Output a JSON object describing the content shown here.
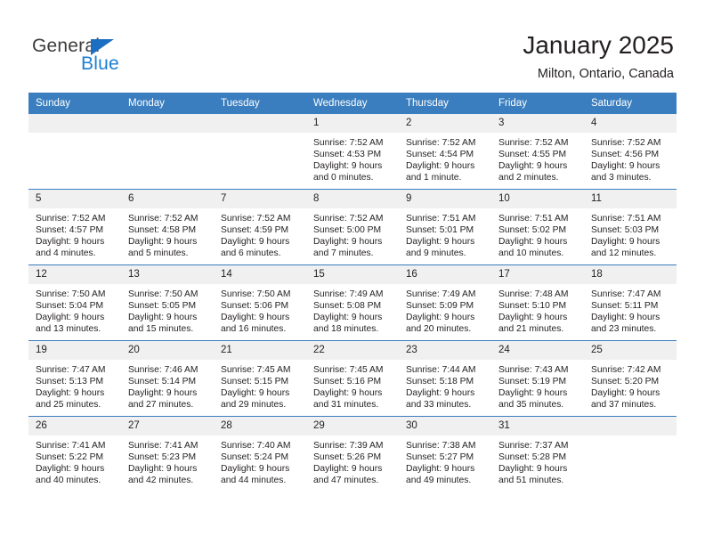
{
  "brand": {
    "name_part1": "General",
    "name_part2": "Blue",
    "accent_color": "#1b7fd4",
    "triangle_color": "#1b6ec2"
  },
  "header": {
    "title": "January 2025",
    "subtitle": "Milton, Ontario, Canada"
  },
  "calendar": {
    "header_bg": "#3a7ebf",
    "daynum_bg": "#f0f0f0",
    "weekdays": [
      "Sunday",
      "Monday",
      "Tuesday",
      "Wednesday",
      "Thursday",
      "Friday",
      "Saturday"
    ],
    "weeks": [
      [
        {
          "day": "",
          "lines": []
        },
        {
          "day": "",
          "lines": []
        },
        {
          "day": "",
          "lines": []
        },
        {
          "day": "1",
          "lines": [
            "Sunrise: 7:52 AM",
            "Sunset: 4:53 PM",
            "Daylight: 9 hours",
            "and 0 minutes."
          ]
        },
        {
          "day": "2",
          "lines": [
            "Sunrise: 7:52 AM",
            "Sunset: 4:54 PM",
            "Daylight: 9 hours",
            "and 1 minute."
          ]
        },
        {
          "day": "3",
          "lines": [
            "Sunrise: 7:52 AM",
            "Sunset: 4:55 PM",
            "Daylight: 9 hours",
            "and 2 minutes."
          ]
        },
        {
          "day": "4",
          "lines": [
            "Sunrise: 7:52 AM",
            "Sunset: 4:56 PM",
            "Daylight: 9 hours",
            "and 3 minutes."
          ]
        }
      ],
      [
        {
          "day": "5",
          "lines": [
            "Sunrise: 7:52 AM",
            "Sunset: 4:57 PM",
            "Daylight: 9 hours",
            "and 4 minutes."
          ]
        },
        {
          "day": "6",
          "lines": [
            "Sunrise: 7:52 AM",
            "Sunset: 4:58 PM",
            "Daylight: 9 hours",
            "and 5 minutes."
          ]
        },
        {
          "day": "7",
          "lines": [
            "Sunrise: 7:52 AM",
            "Sunset: 4:59 PM",
            "Daylight: 9 hours",
            "and 6 minutes."
          ]
        },
        {
          "day": "8",
          "lines": [
            "Sunrise: 7:52 AM",
            "Sunset: 5:00 PM",
            "Daylight: 9 hours",
            "and 7 minutes."
          ]
        },
        {
          "day": "9",
          "lines": [
            "Sunrise: 7:51 AM",
            "Sunset: 5:01 PM",
            "Daylight: 9 hours",
            "and 9 minutes."
          ]
        },
        {
          "day": "10",
          "lines": [
            "Sunrise: 7:51 AM",
            "Sunset: 5:02 PM",
            "Daylight: 9 hours",
            "and 10 minutes."
          ]
        },
        {
          "day": "11",
          "lines": [
            "Sunrise: 7:51 AM",
            "Sunset: 5:03 PM",
            "Daylight: 9 hours",
            "and 12 minutes."
          ]
        }
      ],
      [
        {
          "day": "12",
          "lines": [
            "Sunrise: 7:50 AM",
            "Sunset: 5:04 PM",
            "Daylight: 9 hours",
            "and 13 minutes."
          ]
        },
        {
          "day": "13",
          "lines": [
            "Sunrise: 7:50 AM",
            "Sunset: 5:05 PM",
            "Daylight: 9 hours",
            "and 15 minutes."
          ]
        },
        {
          "day": "14",
          "lines": [
            "Sunrise: 7:50 AM",
            "Sunset: 5:06 PM",
            "Daylight: 9 hours",
            "and 16 minutes."
          ]
        },
        {
          "day": "15",
          "lines": [
            "Sunrise: 7:49 AM",
            "Sunset: 5:08 PM",
            "Daylight: 9 hours",
            "and 18 minutes."
          ]
        },
        {
          "day": "16",
          "lines": [
            "Sunrise: 7:49 AM",
            "Sunset: 5:09 PM",
            "Daylight: 9 hours",
            "and 20 minutes."
          ]
        },
        {
          "day": "17",
          "lines": [
            "Sunrise: 7:48 AM",
            "Sunset: 5:10 PM",
            "Daylight: 9 hours",
            "and 21 minutes."
          ]
        },
        {
          "day": "18",
          "lines": [
            "Sunrise: 7:47 AM",
            "Sunset: 5:11 PM",
            "Daylight: 9 hours",
            "and 23 minutes."
          ]
        }
      ],
      [
        {
          "day": "19",
          "lines": [
            "Sunrise: 7:47 AM",
            "Sunset: 5:13 PM",
            "Daylight: 9 hours",
            "and 25 minutes."
          ]
        },
        {
          "day": "20",
          "lines": [
            "Sunrise: 7:46 AM",
            "Sunset: 5:14 PM",
            "Daylight: 9 hours",
            "and 27 minutes."
          ]
        },
        {
          "day": "21",
          "lines": [
            "Sunrise: 7:45 AM",
            "Sunset: 5:15 PM",
            "Daylight: 9 hours",
            "and 29 minutes."
          ]
        },
        {
          "day": "22",
          "lines": [
            "Sunrise: 7:45 AM",
            "Sunset: 5:16 PM",
            "Daylight: 9 hours",
            "and 31 minutes."
          ]
        },
        {
          "day": "23",
          "lines": [
            "Sunrise: 7:44 AM",
            "Sunset: 5:18 PM",
            "Daylight: 9 hours",
            "and 33 minutes."
          ]
        },
        {
          "day": "24",
          "lines": [
            "Sunrise: 7:43 AM",
            "Sunset: 5:19 PM",
            "Daylight: 9 hours",
            "and 35 minutes."
          ]
        },
        {
          "day": "25",
          "lines": [
            "Sunrise: 7:42 AM",
            "Sunset: 5:20 PM",
            "Daylight: 9 hours",
            "and 37 minutes."
          ]
        }
      ],
      [
        {
          "day": "26",
          "lines": [
            "Sunrise: 7:41 AM",
            "Sunset: 5:22 PM",
            "Daylight: 9 hours",
            "and 40 minutes."
          ]
        },
        {
          "day": "27",
          "lines": [
            "Sunrise: 7:41 AM",
            "Sunset: 5:23 PM",
            "Daylight: 9 hours",
            "and 42 minutes."
          ]
        },
        {
          "day": "28",
          "lines": [
            "Sunrise: 7:40 AM",
            "Sunset: 5:24 PM",
            "Daylight: 9 hours",
            "and 44 minutes."
          ]
        },
        {
          "day": "29",
          "lines": [
            "Sunrise: 7:39 AM",
            "Sunset: 5:26 PM",
            "Daylight: 9 hours",
            "and 47 minutes."
          ]
        },
        {
          "day": "30",
          "lines": [
            "Sunrise: 7:38 AM",
            "Sunset: 5:27 PM",
            "Daylight: 9 hours",
            "and 49 minutes."
          ]
        },
        {
          "day": "31",
          "lines": [
            "Sunrise: 7:37 AM",
            "Sunset: 5:28 PM",
            "Daylight: 9 hours",
            "and 51 minutes."
          ]
        },
        {
          "day": "",
          "lines": []
        }
      ]
    ]
  }
}
